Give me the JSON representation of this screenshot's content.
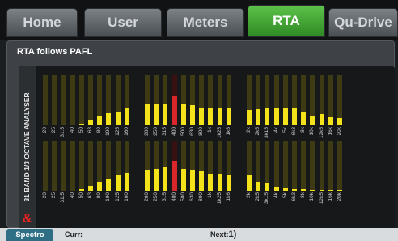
{
  "tabs": [
    {
      "label": "Home",
      "active": false
    },
    {
      "label": "User",
      "active": false
    },
    {
      "label": "Meters",
      "active": false
    },
    {
      "label": "RTA",
      "active": true
    },
    {
      "label": "Qu-Drive",
      "active": false
    }
  ],
  "panel": {
    "title": "RTA follows PAFL",
    "vertical_label": "31 BAND 1/3 OCTAVE ANALYSER",
    "logo": "&"
  },
  "bands": [
    "20",
    "25",
    "31.5",
    "40",
    "50",
    "63",
    "80",
    "100",
    "125",
    "160",
    "200",
    "250",
    "315",
    "400",
    "500",
    "630",
    "800",
    "1k",
    "1k25",
    "1k6",
    "2k",
    "2k5",
    "3k15",
    "4k",
    "5k",
    "6k3",
    "8k",
    "10k",
    "12k5",
    "16k",
    "20k"
  ],
  "peak_band": "400",
  "rows": [
    {
      "name": "top",
      "levels": [
        0,
        0,
        0,
        0,
        0.04,
        0.12,
        0.2,
        0.24,
        0.26,
        0.34,
        0.42,
        0.42,
        0.44,
        0.58,
        0.42,
        0.4,
        0.36,
        0.34,
        0.34,
        0.36,
        0.3,
        0.32,
        0.36,
        0.36,
        0.36,
        0.34,
        0.28,
        0.2,
        0.22,
        0.16,
        0.14
      ]
    },
    {
      "name": "bottom",
      "levels": [
        0,
        0,
        0,
        0,
        0.04,
        0.1,
        0.18,
        0.24,
        0.3,
        0.36,
        0.42,
        0.44,
        0.46,
        0.6,
        0.44,
        0.42,
        0.38,
        0.34,
        0.34,
        0.32,
        0.3,
        0.18,
        0.16,
        0.08,
        0.05,
        0.04,
        0.04,
        0.02,
        0.02,
        0.02,
        0.02
      ]
    }
  ],
  "colors": {
    "accent": "#3aa02c",
    "bar": "#f4e21a",
    "peak": "#d8262a"
  },
  "footer": {
    "mode_button": "Spectro",
    "curr_label": "Curr:",
    "curr_value": "",
    "next_label": "Next:",
    "next_value": "1)"
  }
}
